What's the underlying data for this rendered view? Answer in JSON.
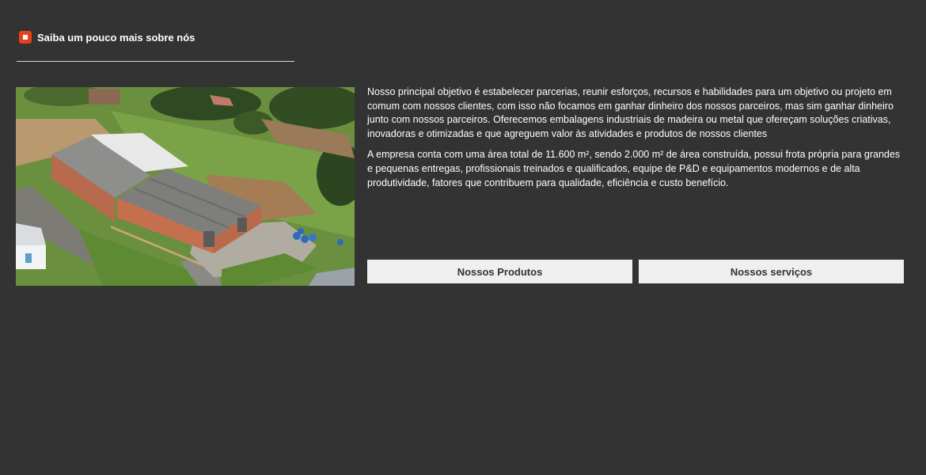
{
  "section": {
    "title": "Saiba um pouco mais sobre nós",
    "icon": "square-bullet-icon",
    "accent_color": "#e8401c"
  },
  "photo": {
    "icon": "aerial-factory-photo"
  },
  "about": {
    "paragraph_1": "Nosso principal objetivo é estabelecer parcerias, reunir esforços, recursos e habilidades para um objetivo ou projeto em comum com nossos clientes, com isso não focamos em ganhar dinheiro dos nossos parceiros, mas sim ganhar dinheiro junto com nossos parceiros. Oferecemos embalagens industriais de madeira ou metal que ofereçam soluções criativas, inovadoras e otimizadas e que agreguem valor às atividades e produtos de nossos clientes",
    "paragraph_2": "A empresa conta com uma área total de 11.600 m², sendo 2.000 m² de área construída, possui frota própria para grandes e pequenas entregas, profissionais treinados e qualificados, equipe de P&D e equipamentos modernos e de alta produtividade, fatores que contribuem para qualidade, eficiência e custo benefício."
  },
  "buttons": {
    "products_label": "Nossos Produtos",
    "services_label": "Nossos serviços"
  },
  "colors": {
    "background": "#333333",
    "button_bg": "#efefef",
    "button_text": "#333333"
  }
}
